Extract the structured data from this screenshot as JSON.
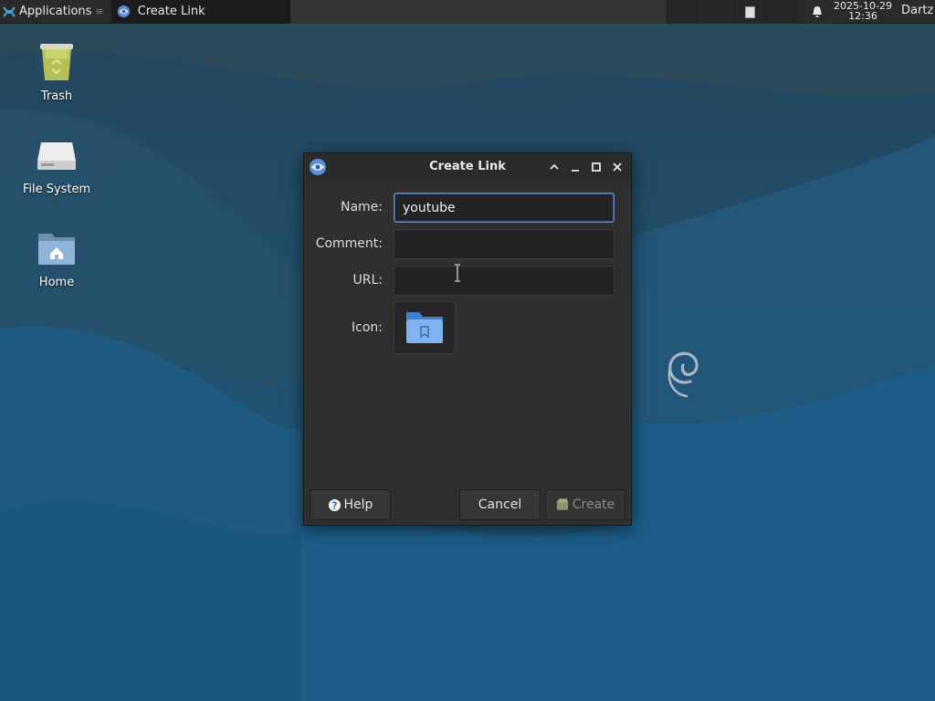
{
  "panel": {
    "applications_label": "Applications",
    "taskbar_item_label": "Create Link",
    "clock_date": "2025-10-29",
    "clock_time": "12:36",
    "user_label": "Dartz"
  },
  "desktop": {
    "icons": [
      {
        "label": "Trash",
        "icon": "trash-icon"
      },
      {
        "label": "File System",
        "icon": "drive-icon"
      },
      {
        "label": "Home",
        "icon": "home-folder-icon"
      }
    ]
  },
  "dialog": {
    "title": "Create Link",
    "fields": {
      "name_label": "Name:",
      "name_value": "youtube",
      "comment_label": "Comment:",
      "comment_value": "",
      "url_label": "URL:",
      "url_value": "",
      "icon_label": "Icon:"
    },
    "buttons": {
      "help": "Help",
      "cancel": "Cancel",
      "create": "Create"
    }
  },
  "colors": {
    "accent": "#5c87c9",
    "wallpaper_base": "#1f4a66",
    "panel_bg": "#2a2a2a",
    "dialog_bg": "#2f2f2f"
  }
}
